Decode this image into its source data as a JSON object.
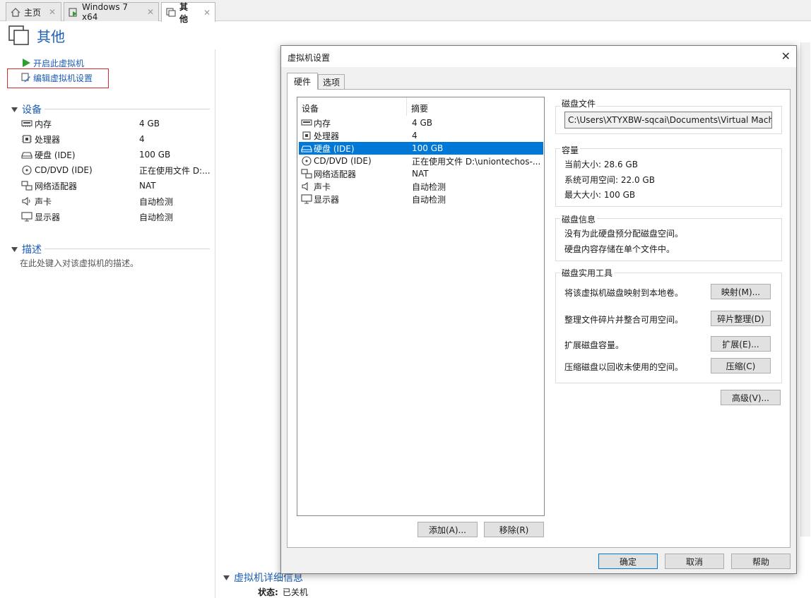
{
  "tabs": [
    {
      "label": "主页",
      "icon": "home-icon"
    },
    {
      "label": "Windows 7 x64",
      "icon": "vm-running-icon"
    },
    {
      "label": "其他",
      "icon": "vm-icon"
    }
  ],
  "page": {
    "title": "其他"
  },
  "actions": {
    "power_on": "开启此虚拟机",
    "edit_settings": "编辑虚拟机设置"
  },
  "devices_section": {
    "title": "设备",
    "items": [
      {
        "name": "内存",
        "value": "4 GB"
      },
      {
        "name": "处理器",
        "value": "4"
      },
      {
        "name": "硬盘 (IDE)",
        "value": "100 GB"
      },
      {
        "name": "CD/DVD (IDE)",
        "value": "正在使用文件 D:..."
      },
      {
        "name": "网络适配器",
        "value": "NAT"
      },
      {
        "name": "声卡",
        "value": "自动检测"
      },
      {
        "name": "显示器",
        "value": "自动检测"
      }
    ]
  },
  "description_section": {
    "title": "描述",
    "placeholder": "在此处键入对该虚拟机的描述。"
  },
  "details_section": {
    "title": "虚拟机详细信息",
    "state_label": "状态:",
    "state_value": "已关机"
  },
  "dialog": {
    "title": "虚拟机设置",
    "close": "✕",
    "tabs": [
      "硬件",
      "选项"
    ],
    "list_headers": {
      "device": "设备",
      "summary": "摘要"
    },
    "devices": [
      {
        "name": "内存",
        "summary": "4 GB",
        "selected": false
      },
      {
        "name": "处理器",
        "summary": "4",
        "selected": false
      },
      {
        "name": "硬盘 (IDE)",
        "summary": "100 GB",
        "selected": true
      },
      {
        "name": "CD/DVD (IDE)",
        "summary": "正在使用文件 D:\\uniontechos-...",
        "selected": false
      },
      {
        "name": "网络适配器",
        "summary": "NAT",
        "selected": false
      },
      {
        "name": "声卡",
        "summary": "自动检测",
        "selected": false
      },
      {
        "name": "显示器",
        "summary": "自动检测",
        "selected": false
      }
    ],
    "add_button": "添加(A)...",
    "remove_button": "移除(R)",
    "disk_file": {
      "title": "磁盘文件",
      "path": "C:\\Users\\XTYXBW-sqcai\\Documents\\Virtual Machines\\"
    },
    "capacity": {
      "title": "容量",
      "current": "当前大小: 28.6 GB",
      "available": "系统可用空间: 22.0 GB",
      "max": "最大大小: 100 GB"
    },
    "disk_info": {
      "title": "磁盘信息",
      "line1": "没有为此硬盘预分配磁盘空间。",
      "line2": "硬盘内容存储在单个文件中。"
    },
    "utilities": {
      "title": "磁盘实用工具",
      "map_text": "将该虚拟机磁盘映射到本地卷。",
      "map_button": "映射(M)...",
      "defrag_text": "整理文件碎片并整合可用空间。",
      "defrag_button": "碎片整理(D)",
      "expand_text": "扩展磁盘容量。",
      "expand_button": "扩展(E)...",
      "compact_text": "压缩磁盘以回收未使用的空间。",
      "compact_button": "压缩(C)"
    },
    "advanced_button": "高级(V)...",
    "ok_button": "确定",
    "cancel_button": "取消",
    "help_button": "帮助"
  }
}
